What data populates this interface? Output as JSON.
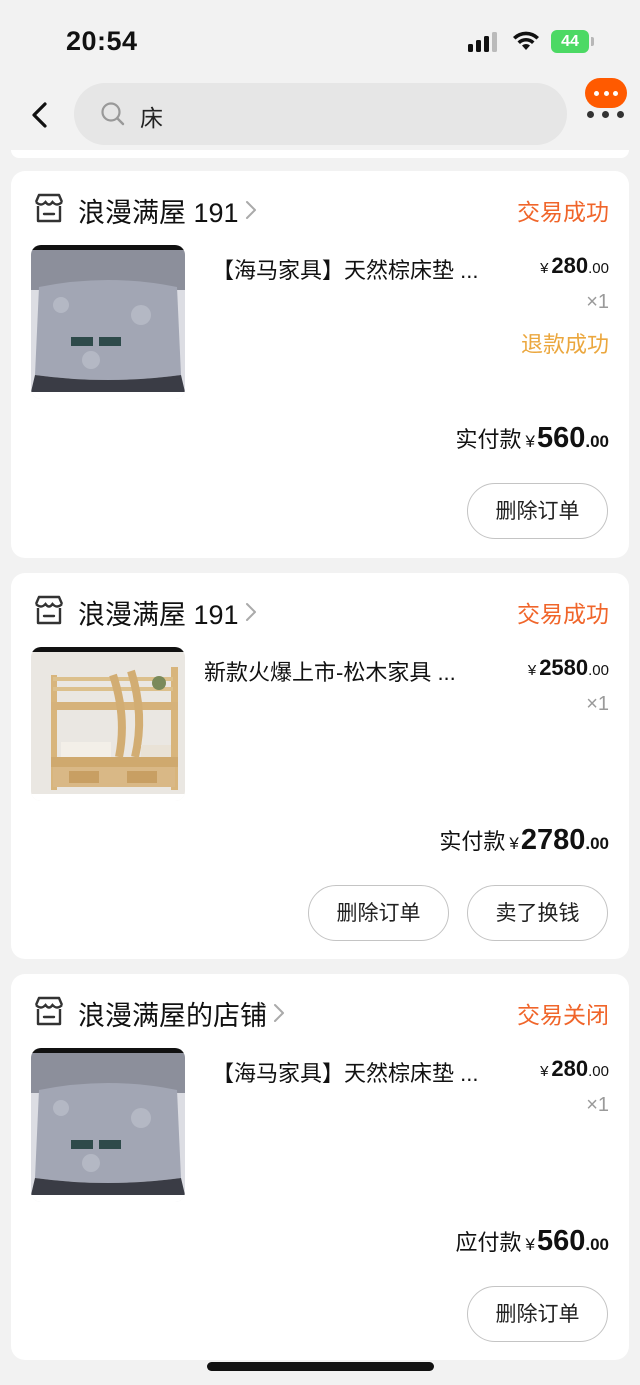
{
  "status_bar": {
    "time": "20:54",
    "battery": "44"
  },
  "search": {
    "query": "床"
  },
  "orders": [
    {
      "shop_name": "浪漫满屋 191",
      "status": "交易成功",
      "product_title": "【海马家具】天然棕床垫 ...",
      "price_currency": "¥",
      "price_int": "280",
      "price_dec": ".00",
      "quantity": "×1",
      "refund_status": "退款成功",
      "paid_label": "实付款",
      "paid_currency": "¥",
      "paid_int": "560",
      "paid_dec": ".00",
      "buttons": [
        "删除订单"
      ]
    },
    {
      "shop_name": "浪漫满屋 191",
      "status": "交易成功",
      "product_title": "新款火爆上市-松木家具 ...",
      "price_currency": "¥",
      "price_int": "2580",
      "price_dec": ".00",
      "quantity": "×1",
      "paid_label": "实付款",
      "paid_currency": "¥",
      "paid_int": "2780",
      "paid_dec": ".00",
      "buttons": [
        "删除订单",
        "卖了换钱"
      ]
    },
    {
      "shop_name": "浪漫满屋的店铺",
      "status": "交易关闭",
      "product_title": "【海马家具】天然棕床垫 ...",
      "price_currency": "¥",
      "price_int": "280",
      "price_dec": ".00",
      "quantity": "×1",
      "paid_label": "应付款",
      "paid_currency": "¥",
      "paid_int": "560",
      "paid_dec": ".00",
      "buttons": [
        "删除订单"
      ]
    }
  ],
  "colors": {
    "accent_orange": "#f0652a",
    "refund_yellow": "#eba73e",
    "battery_green": "#4cd964",
    "menu_bubble": "#ff5a00"
  },
  "icons": {
    "back": "chevron-left-icon",
    "search": "search-icon",
    "shop": "shop-icon",
    "more": "more-icon"
  }
}
